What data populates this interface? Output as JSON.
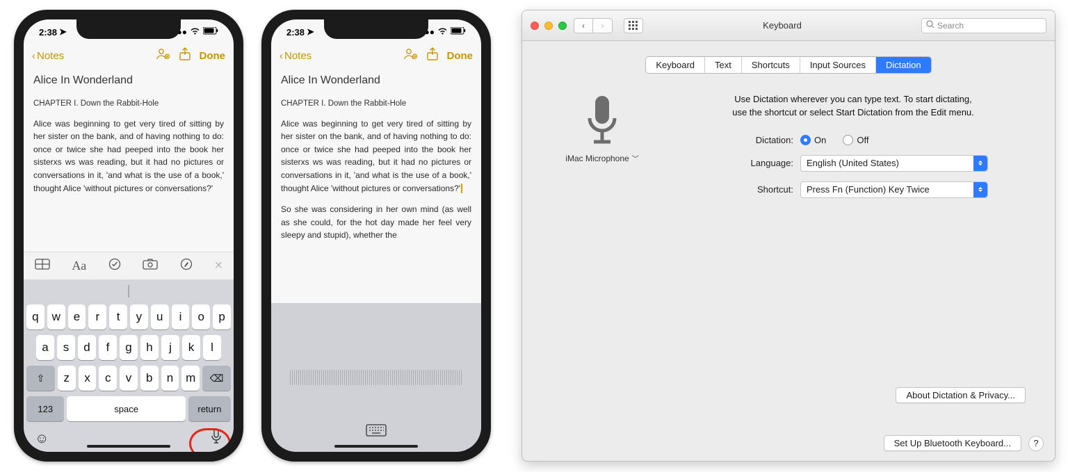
{
  "phone1": {
    "status_time": "2:38",
    "back_label": "Notes",
    "done_label": "Done",
    "note_title": "Alice In Wonderland",
    "chapter": "CHAPTER I. Down the Rabbit-Hole",
    "para1": "Alice was beginning to get very tired of sitting by her sister on the bank, and of having nothing to do: once or twice she had peeped into the book her sisterxs ws was reading, but it had no pictures or conversations in it, 'and what is the use of a book,' thought Alice 'without pictures or conversations?'",
    "keyboard": {
      "row1": [
        "q",
        "w",
        "e",
        "r",
        "t",
        "y",
        "u",
        "i",
        "o",
        "p"
      ],
      "row2": [
        "a",
        "s",
        "d",
        "f",
        "g",
        "h",
        "j",
        "k",
        "l"
      ],
      "row3": [
        "z",
        "x",
        "c",
        "v",
        "b",
        "n",
        "m"
      ],
      "numkey": "123",
      "space": "space",
      "return": "return"
    }
  },
  "phone2": {
    "status_time": "2:38",
    "back_label": "Notes",
    "done_label": "Done",
    "note_title": "Alice In Wonderland",
    "chapter": "CHAPTER I. Down the Rabbit-Hole",
    "para1": "Alice was beginning to get very tired of sitting by her sister on the bank, and of having nothing to do: once or twice she had peeped into the book her sisterxs ws was reading, but it had no pictures or conversations in it, 'and what is the use of a book,' thought Alice 'without pictures or conversations?'",
    "para2": "So she was considering in her own mind (as well as she could, for the hot day made her feel very sleepy and stupid), whether the"
  },
  "mac": {
    "title": "Keyboard",
    "search_placeholder": "Search",
    "tabs": [
      "Keyboard",
      "Text",
      "Shortcuts",
      "Input Sources",
      "Dictation"
    ],
    "active_tab": "Dictation",
    "mic_source": "iMac Microphone",
    "helper_line1": "Use Dictation wherever you can type text. To start dictating,",
    "helper_line2": "use the shortcut or select Start Dictation from the Edit menu.",
    "dictation_label": "Dictation:",
    "on_label": "On",
    "off_label": "Off",
    "dictation_on": true,
    "language_label": "Language:",
    "language_value": "English (United States)",
    "shortcut_label": "Shortcut:",
    "shortcut_value": "Press Fn (Function) Key Twice",
    "about_btn": "About Dictation & Privacy...",
    "bt_btn": "Set Up Bluetooth Keyboard...",
    "help": "?"
  }
}
